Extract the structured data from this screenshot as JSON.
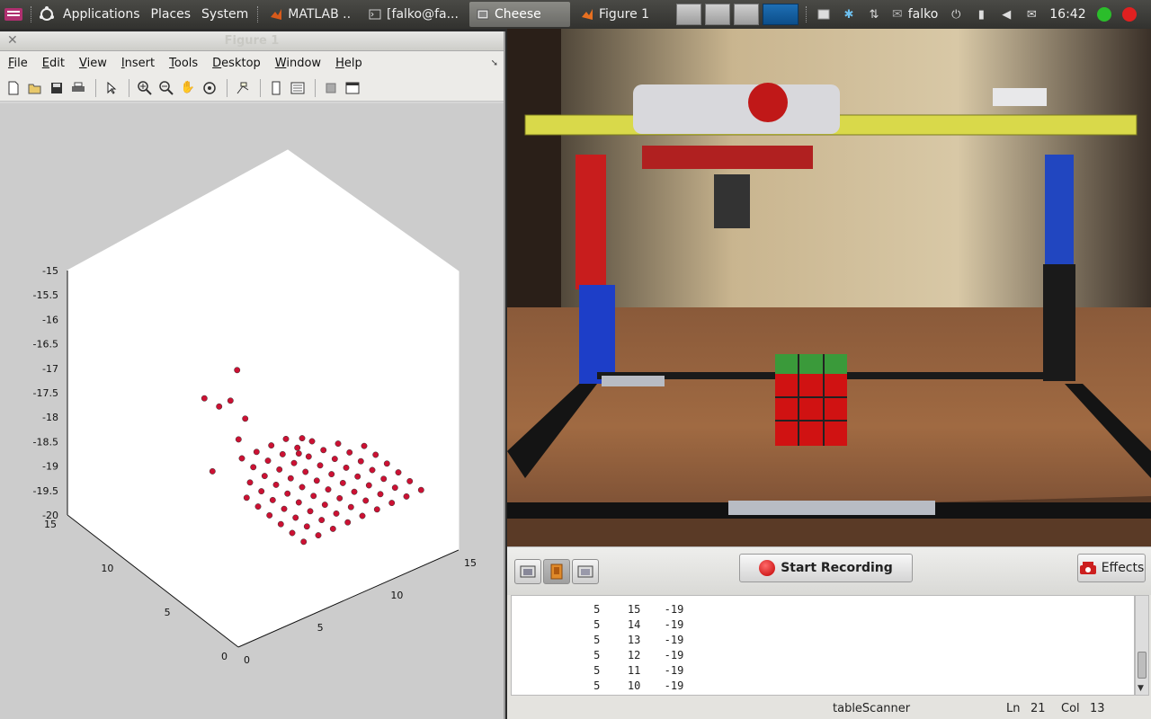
{
  "panel": {
    "menus": [
      "Applications",
      "Places",
      "System"
    ],
    "tasks": [
      {
        "label": "MATLAB  ..",
        "active": false
      },
      {
        "label": "[falko@fa...",
        "active": false
      },
      {
        "label": "Cheese",
        "active": true
      },
      {
        "label": "Figure 1",
        "active": false
      }
    ],
    "user": "falko",
    "clock": "16:42"
  },
  "figure": {
    "title": "Figure 1",
    "menu": [
      "File",
      "Edit",
      "View",
      "Insert",
      "Tools",
      "Desktop",
      "Window",
      "Help"
    ],
    "toolbar_icons": [
      "new-file-icon",
      "open-icon",
      "save-icon",
      "print-icon",
      "pointer-icon",
      "zoom-in-icon",
      "zoom-out-icon",
      "pan-icon",
      "rotate-icon",
      "data-cursor-icon",
      "colorbar-icon",
      "legend-icon",
      "hide-plottools-icon",
      "show-plottools-icon"
    ]
  },
  "chart_data": {
    "type": "scatter",
    "projection": "3d",
    "z_ticks": [
      "-15",
      "-15.5",
      "-16",
      "-16.5",
      "-17",
      "-17.5",
      "-18",
      "-18.5",
      "-19",
      "-19.5",
      "-20"
    ],
    "y_ticks": [
      "15",
      "10",
      "5",
      "0"
    ],
    "x_ticks": [
      "0",
      "5",
      "10",
      "15"
    ],
    "zlim": [
      -20,
      -15
    ],
    "xlim": [
      0,
      15
    ],
    "ylim": [
      0,
      15
    ],
    "grid": false,
    "marker_color": "#cc1133",
    "series": [
      {
        "values": [
          [
            14,
            2,
            -19
          ],
          [
            13,
            2,
            -19
          ],
          [
            12,
            2,
            -19
          ],
          [
            11,
            2,
            -19
          ],
          [
            10,
            2,
            -19
          ],
          [
            9,
            2,
            -19
          ],
          [
            8,
            2,
            -19
          ],
          [
            7,
            2,
            -19
          ],
          [
            6,
            2,
            -19
          ],
          [
            14,
            3,
            -19
          ],
          [
            13,
            3,
            -19
          ],
          [
            12,
            3,
            -19
          ],
          [
            11,
            3,
            -19
          ],
          [
            10,
            3,
            -19
          ],
          [
            9,
            3,
            -19
          ],
          [
            8,
            3,
            -19
          ],
          [
            7,
            3,
            -19
          ],
          [
            6,
            3,
            -19
          ],
          [
            14,
            4,
            -19
          ],
          [
            13,
            4,
            -19
          ],
          [
            12,
            4,
            -19
          ],
          [
            11,
            4,
            -19
          ],
          [
            10,
            4,
            -19
          ],
          [
            9,
            4,
            -19
          ],
          [
            8,
            4,
            -19
          ],
          [
            7,
            4,
            -19
          ],
          [
            6,
            4,
            -19
          ],
          [
            14,
            5,
            -19
          ],
          [
            13,
            5,
            -19
          ],
          [
            12,
            5,
            -19
          ],
          [
            11,
            5,
            -19
          ],
          [
            10,
            5,
            -19
          ],
          [
            9,
            5,
            -19
          ],
          [
            8,
            5,
            -19
          ],
          [
            7,
            5,
            -19
          ],
          [
            6,
            5,
            -19
          ],
          [
            14,
            6,
            -19
          ],
          [
            13,
            6,
            -19
          ],
          [
            12,
            6,
            -19
          ],
          [
            11,
            6,
            -19
          ],
          [
            10,
            6,
            -19
          ],
          [
            9,
            6,
            -19
          ],
          [
            8,
            6,
            -19
          ],
          [
            7,
            6,
            -19
          ],
          [
            6,
            6,
            -19
          ],
          [
            14,
            7,
            -19
          ],
          [
            13,
            7,
            -19
          ],
          [
            12,
            7,
            -19
          ],
          [
            11,
            7,
            -19
          ],
          [
            10,
            7,
            -19
          ],
          [
            9,
            7,
            -19
          ],
          [
            8,
            7,
            -19
          ],
          [
            7,
            7,
            -19
          ],
          [
            6,
            7,
            -19
          ],
          [
            13,
            8,
            -19
          ],
          [
            12,
            8,
            -19
          ],
          [
            11,
            8,
            -19
          ],
          [
            10,
            8,
            -19
          ],
          [
            9,
            8,
            -19
          ],
          [
            8,
            8,
            -19
          ],
          [
            7,
            8,
            -19
          ],
          [
            12,
            9,
            -19
          ],
          [
            11,
            9,
            -19
          ],
          [
            10,
            9,
            -19
          ],
          [
            9,
            9,
            -19
          ],
          [
            8,
            9,
            -19
          ],
          [
            8,
            10,
            -19
          ],
          [
            9,
            10,
            -19
          ],
          [
            10,
            10,
            -19
          ],
          [
            11,
            10,
            -19
          ],
          [
            7,
            12,
            -18
          ],
          [
            8,
            11,
            -18
          ],
          [
            8,
            12,
            -18.3
          ],
          [
            9,
            11,
            -18.5
          ],
          [
            6,
            10,
            -19
          ],
          [
            9,
            6,
            -18
          ],
          [
            8,
            5,
            -18
          ],
          [
            7,
            9,
            -18.3
          ],
          [
            10,
            13,
            -18
          ]
        ]
      }
    ]
  },
  "cheese": {
    "start_recording_label": "Start Recording",
    "effects_label": "Effects"
  },
  "editor": {
    "lines": [
      [
        "5",
        "15",
        "-19"
      ],
      [
        "5",
        "14",
        "-19"
      ],
      [
        "5",
        "13",
        "-19"
      ],
      [
        "5",
        "12",
        "-19"
      ],
      [
        "5",
        "11",
        "-19"
      ],
      [
        "5",
        "10",
        "-19"
      ]
    ],
    "status": {
      "script": "tableScanner",
      "ln_label": "Ln",
      "ln": "21",
      "col_label": "Col",
      "col": "13"
    }
  }
}
